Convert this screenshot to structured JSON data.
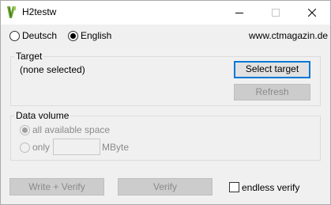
{
  "titlebar": {
    "title": "H2testw",
    "icon": "h2testw-app-icon"
  },
  "language": {
    "options": [
      {
        "label": "Deutsch",
        "selected": false
      },
      {
        "label": "English",
        "selected": true
      }
    ],
    "website": "www.ctmagazin.de"
  },
  "target": {
    "group_title": "Target",
    "selection_text": "(none selected)",
    "select_button": "Select target",
    "refresh_button": "Refresh"
  },
  "data_volume": {
    "group_title": "Data volume",
    "all_space_label": "all available space",
    "only_label": "only",
    "only_value": "",
    "unit_label": "MByte"
  },
  "actions": {
    "write_verify_button": "Write + Verify",
    "verify_button": "Verify",
    "endless_verify_label": "endless verify",
    "endless_verify_checked": false
  }
}
